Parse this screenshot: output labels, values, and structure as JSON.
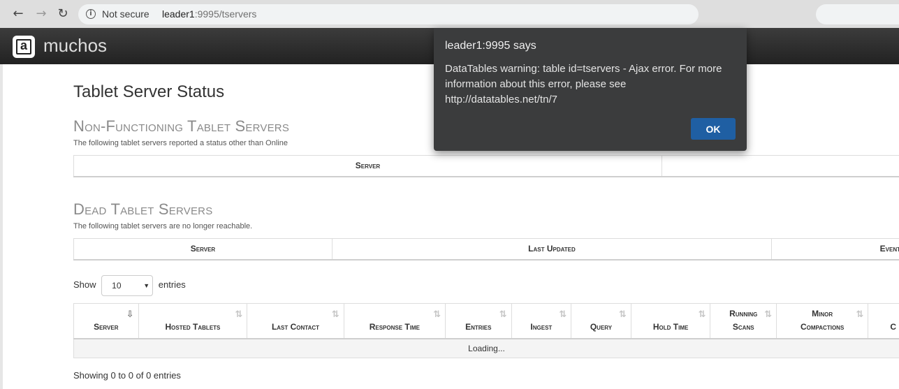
{
  "browser": {
    "security_text": "Not secure",
    "url_host": "leader1",
    "url_path": ":9995/tservers"
  },
  "app": {
    "brand": "muchos"
  },
  "page": {
    "title": "Tablet Server Status"
  },
  "non_functioning": {
    "title": "Non-Functioning Tablet Servers",
    "description": "The following tablet servers reported a status other than Online",
    "columns": [
      "Server",
      ""
    ]
  },
  "dead": {
    "title": "Dead Tablet Servers",
    "description": "The following tablet servers are no longer reachable.",
    "columns": [
      "Server",
      "Last Updated",
      "Event"
    ]
  },
  "length_menu": {
    "show_label": "Show",
    "selected": "10",
    "entries_label": "entries"
  },
  "tservers_table": {
    "columns": [
      {
        "line1": "",
        "line2": "Server"
      },
      {
        "line1": "",
        "line2": "Hosted Tablets"
      },
      {
        "line1": "",
        "line2": "Last Contact"
      },
      {
        "line1": "",
        "line2": "Response Time"
      },
      {
        "line1": "",
        "line2": "Entries"
      },
      {
        "line1": "",
        "line2": "Ingest"
      },
      {
        "line1": "",
        "line2": "Query"
      },
      {
        "line1": "",
        "line2": "Hold Time"
      },
      {
        "line1": "Running",
        "line2": "Scans"
      },
      {
        "line1": "Minor",
        "line2": "Compactions"
      },
      {
        "line1": "",
        "line2": "C"
      }
    ],
    "loading_text": "Loading...",
    "info": "Showing 0 to 0 of 0 entries"
  },
  "dialog": {
    "title": "leader1:9995 says",
    "message": "DataTables warning: table id=tservers - Ajax error. For more information about this error, please see http://datatables.net/tn/7",
    "ok_label": "OK"
  }
}
